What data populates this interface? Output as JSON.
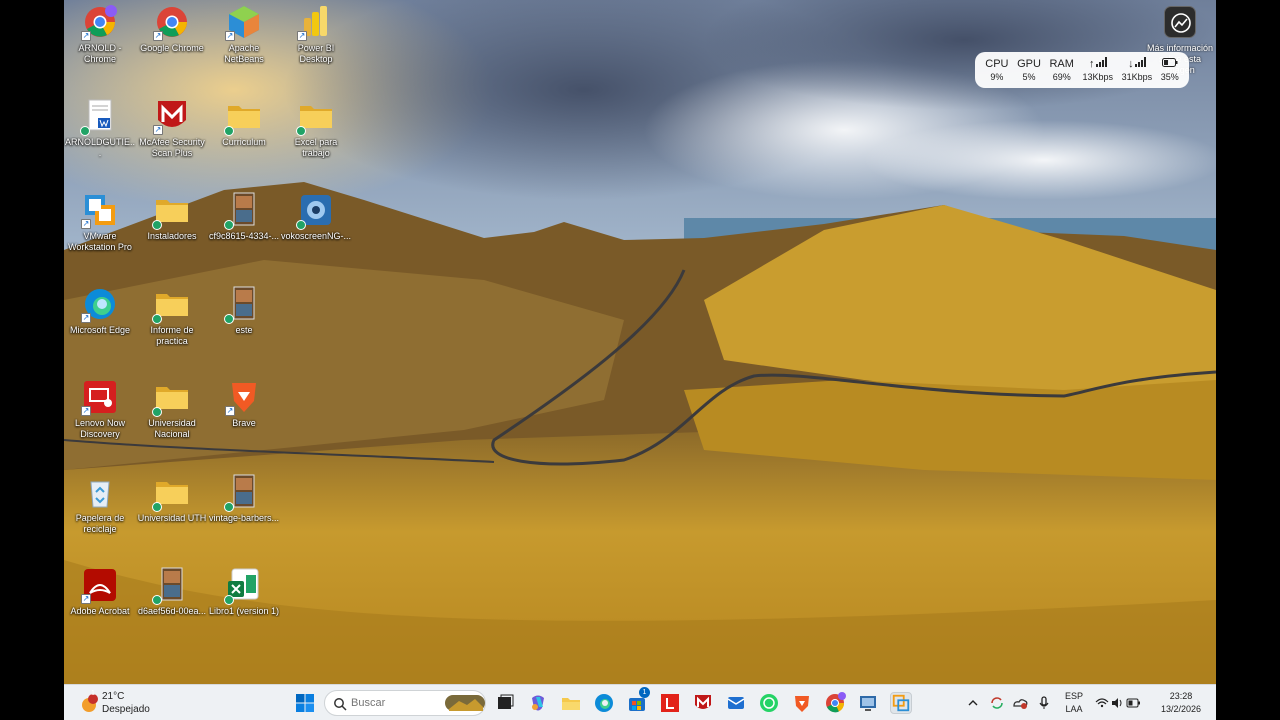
{
  "desktop": {
    "icons": [
      {
        "label": "ARNOLD - Chrome",
        "icon": "chrome-profile-icon"
      },
      {
        "label": "Google Chrome",
        "icon": "chrome-icon"
      },
      {
        "label": "Apache NetBeans",
        "icon": "netbeans-icon"
      },
      {
        "label": "Power BI Desktop",
        "icon": "powerbi-icon"
      },
      {
        "label": "ARNOLDGUTIE...",
        "icon": "word-document-icon"
      },
      {
        "label": "McAfee Security Scan Plus",
        "icon": "mcafee-icon"
      },
      {
        "label": "Curriculum",
        "icon": "folder-icon"
      },
      {
        "label": "Excel para trabajo",
        "icon": "folder-icon"
      },
      {
        "label": "VMware Workstation Pro",
        "icon": "vmware-icon"
      },
      {
        "label": "Instaladores",
        "icon": "folder-icon"
      },
      {
        "label": "cf9c8615-4334-...",
        "icon": "image-file-icon"
      },
      {
        "label": "vokoscreenNG-...",
        "icon": "vokoscreen-icon"
      },
      {
        "label": "Microsoft Edge",
        "icon": "edge-icon"
      },
      {
        "label": "Informe de practica",
        "icon": "folder-icon"
      },
      {
        "label": "este",
        "icon": "image-file-icon"
      },
      {
        "label": "Lenovo Now Discovery",
        "icon": "lenovo-now-icon"
      },
      {
        "label": "Universidad Nacional",
        "icon": "folder-icon"
      },
      {
        "label": "Brave",
        "icon": "brave-icon"
      },
      {
        "label": "Papelera de reciclaje",
        "icon": "recycle-bin-icon"
      },
      {
        "label": "Universidad UTH",
        "icon": "folder-icon"
      },
      {
        "label": "vintage-barbers...",
        "icon": "image-file-icon"
      },
      {
        "label": "Adobe Acrobat",
        "icon": "acrobat-icon"
      },
      {
        "label": "d6aef56d-00ea...",
        "icon": "image-file-icon"
      },
      {
        "label": "Libro1 (version 1)",
        "icon": "excel-icon"
      }
    ]
  },
  "widget": {
    "label": "Más información sobre esta imagen"
  },
  "performance": {
    "items": [
      {
        "label": "CPU",
        "value": "9%"
      },
      {
        "label": "GPU",
        "value": "5%"
      },
      {
        "label": "RAM",
        "value": "69%"
      },
      {
        "label": "↑",
        "value": "13Kbps"
      },
      {
        "label": "↓",
        "value": "31Kbps"
      },
      {
        "label": "battery",
        "value": "35%"
      }
    ]
  },
  "taskbar": {
    "weather": {
      "temp": "21°C",
      "condition": "Despejado",
      "badge": "1"
    },
    "search_placeholder": "Buscar",
    "store_badge": "1",
    "tray": {
      "language": "ESP",
      "layout": "LAA",
      "time": "23:28",
      "date": "13/2/2026"
    }
  },
  "colors": {
    "taskbar": "#eef1f4",
    "folder": "#f5c94c",
    "accent": "#0067c0"
  }
}
